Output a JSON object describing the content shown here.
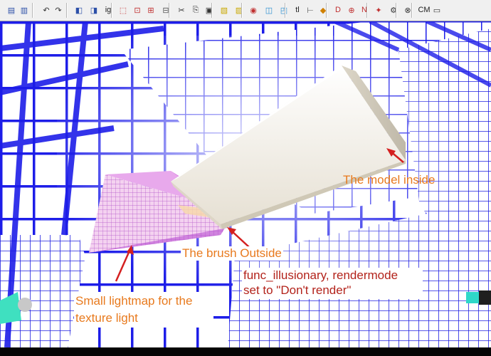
{
  "toolbar": {
    "buttons": [
      {
        "name": "open-map-icon",
        "glyph": "▤"
      },
      {
        "name": "save-map-icon",
        "glyph": "▥"
      },
      {
        "name": "undo-icon",
        "glyph": "↶"
      },
      {
        "name": "redo-icon",
        "glyph": "↷"
      },
      {
        "name": "cube-icon",
        "glyph": "◧"
      },
      {
        "name": "group-icon",
        "glyph": "◨"
      },
      {
        "name": "ig-toggle",
        "glyph": "ig"
      },
      {
        "name": "select-icon",
        "glyph": "⬚"
      },
      {
        "name": "texture-lock-icon",
        "glyph": "⊡"
      },
      {
        "name": "uv-lock-icon",
        "glyph": "⊞"
      },
      {
        "name": "grid-icon",
        "glyph": "⊟"
      },
      {
        "name": "cut-icon",
        "glyph": "✂"
      },
      {
        "name": "copy-icon",
        "glyph": "⎘"
      },
      {
        "name": "paste-icon",
        "glyph": "▣"
      },
      {
        "name": "carve-icon",
        "glyph": "▧"
      },
      {
        "name": "hollow-icon",
        "glyph": "▨"
      },
      {
        "name": "run-map-icon",
        "glyph": "◉"
      },
      {
        "name": "clip-tool-icon",
        "glyph": "◫"
      },
      {
        "name": "vertex-tool-icon",
        "glyph": "◰"
      },
      {
        "name": "tl-toggle",
        "glyph": "tl"
      },
      {
        "name": "align-icon",
        "glyph": "⊢"
      },
      {
        "name": "texture-app-icon",
        "glyph": "◆"
      },
      {
        "name": "decal-icon",
        "glyph": "D"
      },
      {
        "name": "overlay-icon",
        "glyph": "⊕"
      },
      {
        "name": "entity-icon",
        "glyph": "N"
      },
      {
        "name": "light-icon",
        "glyph": "✦"
      },
      {
        "name": "gear-icon",
        "glyph": "⚙"
      },
      {
        "name": "globe-icon",
        "glyph": "⊗"
      },
      {
        "name": "cm-toggle",
        "glyph": "CM"
      },
      {
        "name": "camera-icon",
        "glyph": "▭"
      }
    ]
  },
  "annotations": {
    "model_inside": "The model inside",
    "brush_outside": "The brush Outside",
    "func_line1": "func_illusionary, rendermode",
    "func_line2": "set to \"Don't render\"",
    "lightmap_line1": "Small lightmap for the",
    "lightmap_line2": "texture light"
  },
  "colors": {
    "grid": "#1d1de8",
    "annotation_orange": "#e87a1e",
    "annotation_red": "#b3231b",
    "arrow": "#d42020",
    "model_face": "#f1ede4",
    "brush_pink": "#f3c7ef"
  }
}
